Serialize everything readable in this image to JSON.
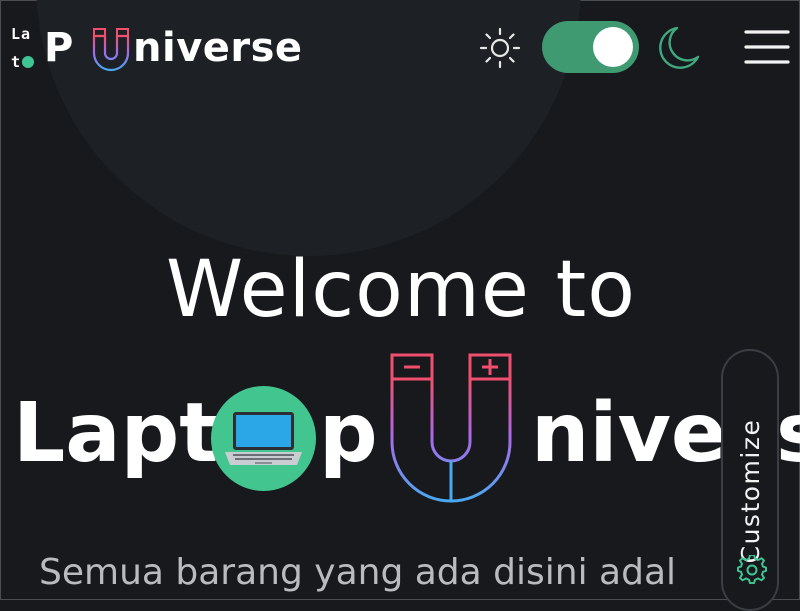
{
  "header": {
    "logo": {
      "small_top": "La",
      "small_bottom": "t",
      "letter_p": "P",
      "rest": "niverse"
    },
    "icons": {
      "sun": "sun-icon",
      "moon": "moon-icon",
      "menu": "menu-icon"
    },
    "theme_toggle": {
      "state": "on"
    }
  },
  "hero": {
    "title": "Welcome to",
    "brand": {
      "lapt": "Lapt",
      "p": "p",
      "nive": "nive",
      "s": "s"
    },
    "tagline": "Semua barang yang ada disini adal"
  },
  "customize": {
    "label": "Customize",
    "icon": "gear-icon"
  },
  "colors": {
    "background": "#17191d",
    "accent_green": "#3fc594",
    "toggle_green": "#3f9a72",
    "magnet_red": "#f0506e",
    "magnet_purple": "#a06cf0",
    "magnet_blue": "#4aa8f0"
  }
}
